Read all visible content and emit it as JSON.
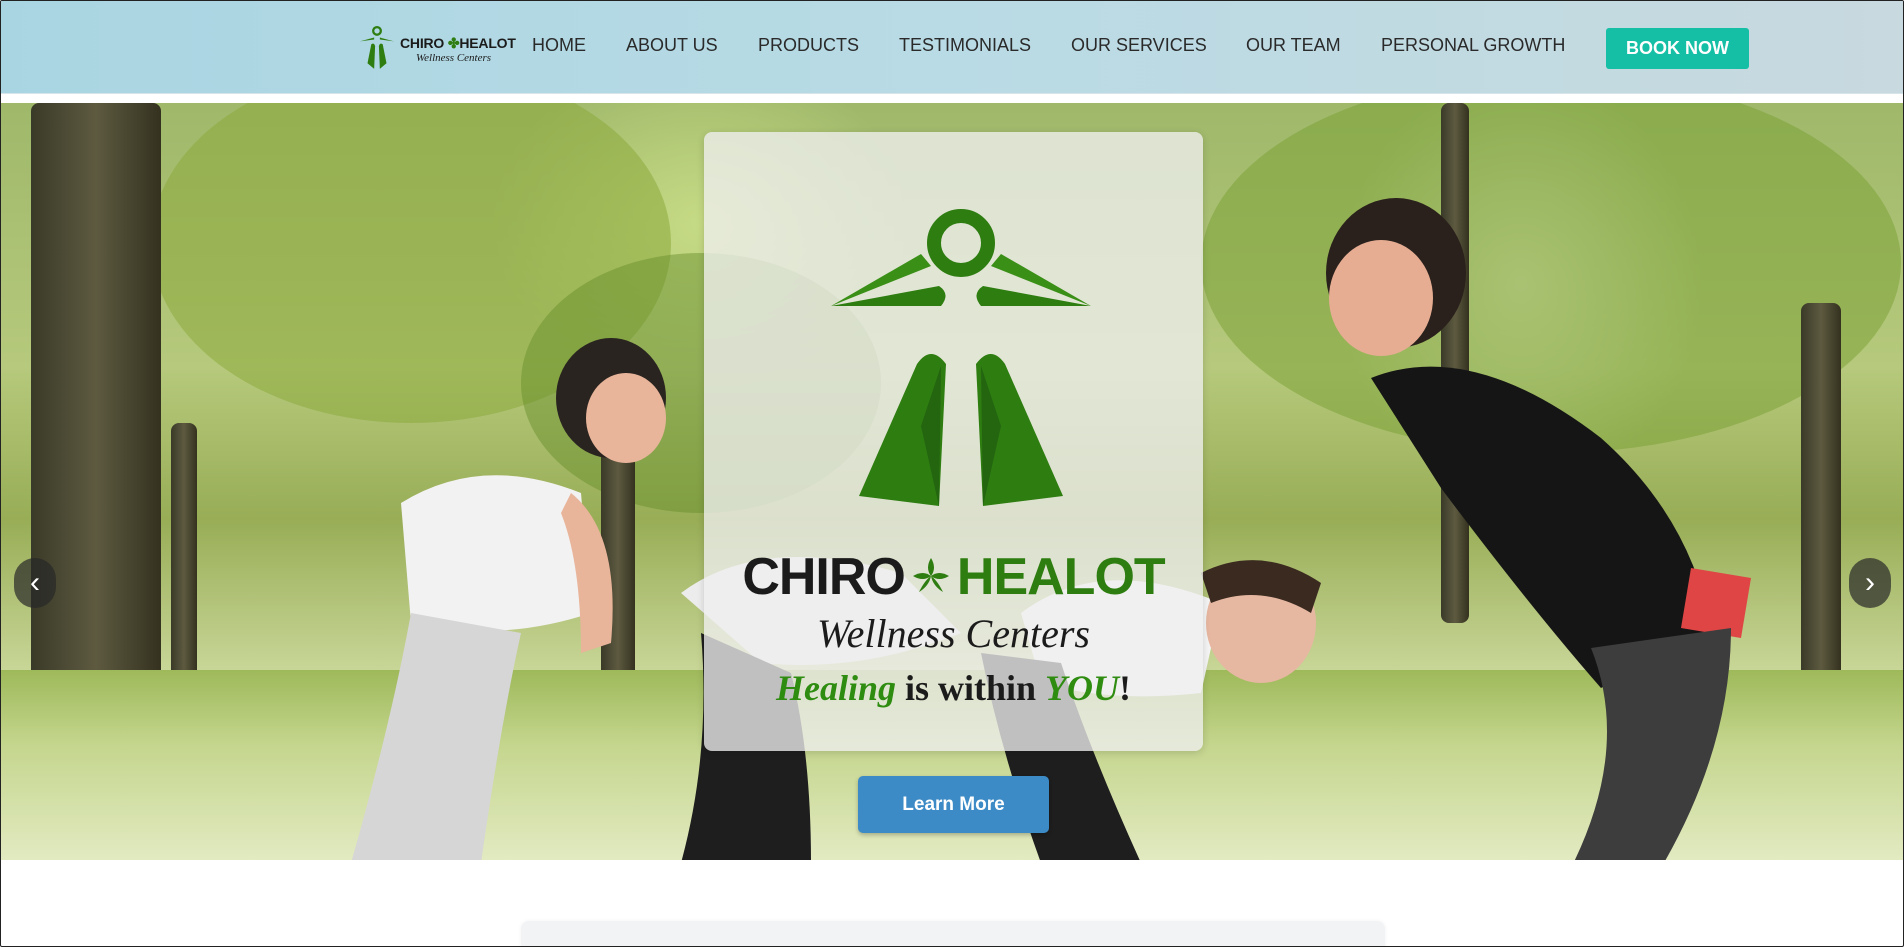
{
  "header": {
    "logo": {
      "brand_left": "CHIRO",
      "brand_right": "HEALOT",
      "tagline": "Wellness Centers"
    },
    "nav": [
      {
        "label": "HOME"
      },
      {
        "label": "ABOUT US"
      },
      {
        "label": "PRODUCTS"
      },
      {
        "label": "TESTIMONIALS"
      },
      {
        "label": "OUR SERVICES"
      },
      {
        "label": "OUR TEAM"
      },
      {
        "label": "PERSONAL GROWTH"
      }
    ],
    "book_button": "BOOK NOW"
  },
  "hero": {
    "prev_arrow": "‹",
    "next_arrow": "›",
    "card": {
      "brand_left": "CHIRO",
      "brand_right": "HEALOT",
      "tagline": "Wellness Centers",
      "slogan_word1": "Healing",
      "slogan_mid": " is within ",
      "slogan_word2": "YOU",
      "slogan_end": "!"
    },
    "cta": "Learn More"
  },
  "colors": {
    "header_bg": "#b3d8e3",
    "accent_teal": "#15bfa5",
    "brand_green": "#2e7d10",
    "cta_blue": "#3d8bc6"
  }
}
